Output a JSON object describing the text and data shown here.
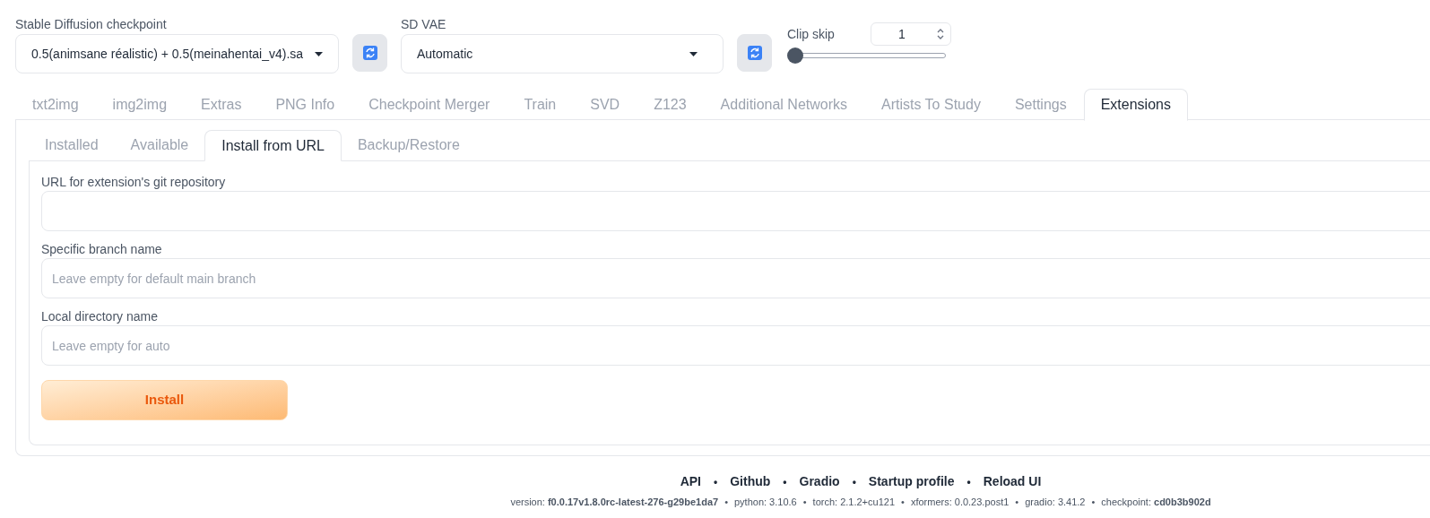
{
  "checkpoint": {
    "label": "Stable Diffusion checkpoint",
    "value": "0.5(animsane réalistic) + 0.5(meinahentai_v4).sa"
  },
  "vae": {
    "label": "SD VAE",
    "value": "Automatic"
  },
  "clip_skip": {
    "label": "Clip skip",
    "value": "1",
    "level": 0
  },
  "tabs": [
    {
      "label": "txt2img",
      "selected": false
    },
    {
      "label": "img2img",
      "selected": false
    },
    {
      "label": "Extras",
      "selected": false
    },
    {
      "label": "PNG Info",
      "selected": false
    },
    {
      "label": "Checkpoint Merger",
      "selected": false
    },
    {
      "label": "Train",
      "selected": false
    },
    {
      "label": "SVD",
      "selected": false
    },
    {
      "label": "Z123",
      "selected": false
    },
    {
      "label": "Additional Networks",
      "selected": false
    },
    {
      "label": "Artists To Study",
      "selected": false
    },
    {
      "label": "Settings",
      "selected": false
    },
    {
      "label": "Extensions",
      "selected": true
    }
  ],
  "subtabs": [
    {
      "label": "Installed",
      "selected": false
    },
    {
      "label": "Available",
      "selected": false
    },
    {
      "label": "Install from URL",
      "selected": true
    },
    {
      "label": "Backup/Restore",
      "selected": false
    }
  ],
  "fields": [
    {
      "label": "URL for extension's git repository"
    },
    {
      "label": "Specific branch name",
      "placeholder": "Leave empty for default main branch"
    },
    {
      "label": "Local directory name",
      "placeholder": "Leave empty for auto"
    }
  ],
  "install_button": "Install",
  "footer": {
    "links": [
      "API",
      "Github",
      "Gradio",
      "Startup profile",
      "Reload UI"
    ],
    "separator": "•",
    "versions": [
      "version: **f0.0.17v1.8.0rc-latest-276-g29be1da7**",
      "python: 3.10.6",
      "torch: 2.1.2+cu121",
      "xformers: 0.0.23.post1",
      "gradio: 3.41.2",
      "checkpoint: **cd0b3b902d**"
    ]
  }
}
